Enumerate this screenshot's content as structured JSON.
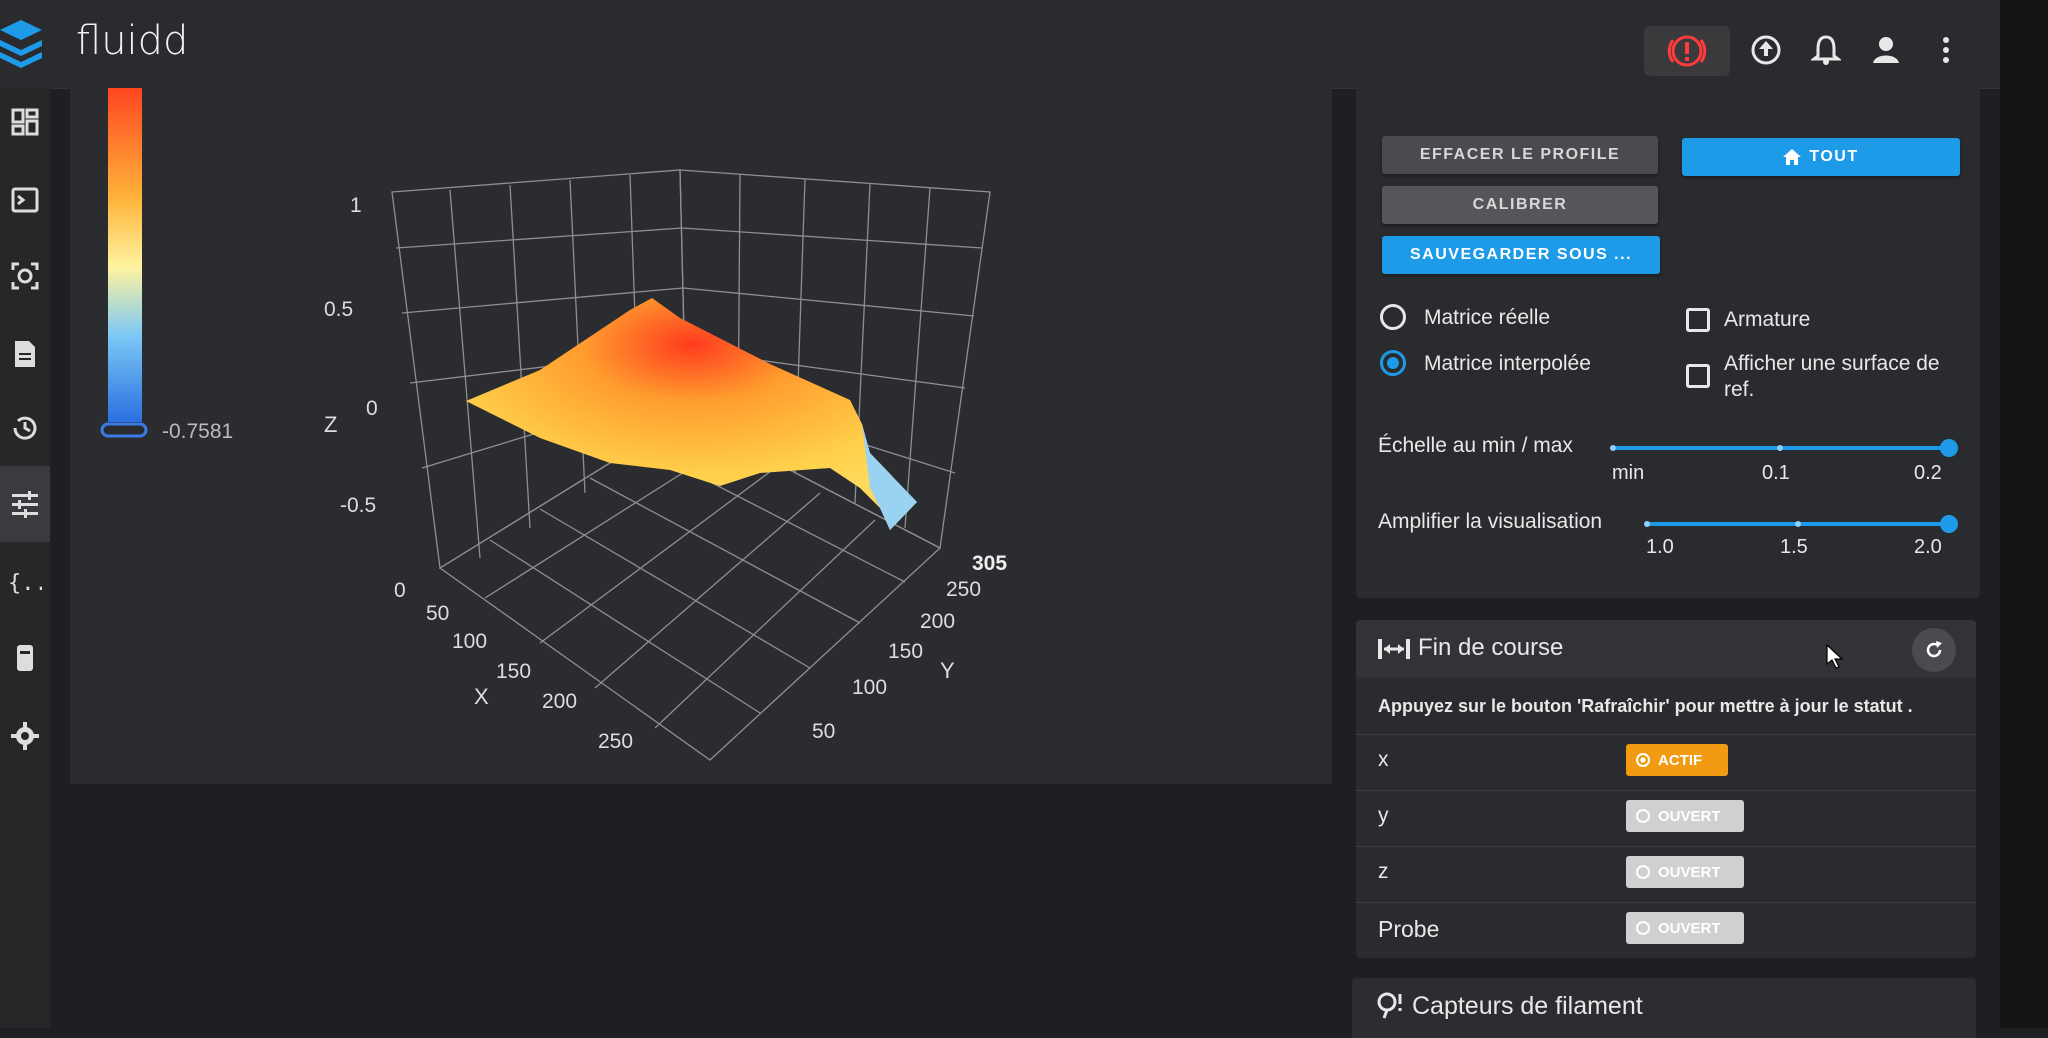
{
  "app": {
    "title": "fluidd"
  },
  "topbar": {
    "icons": [
      "emergency-stop-icon",
      "upload-icon",
      "bell-icon",
      "account-icon",
      "more-vert-icon"
    ]
  },
  "sidebar": {
    "items": [
      {
        "icon": "dashboard-icon"
      },
      {
        "icon": "console-icon"
      },
      {
        "icon": "camera-icon"
      },
      {
        "icon": "files-icon"
      },
      {
        "icon": "history-icon"
      },
      {
        "icon": "tune-icon",
        "active": true
      },
      {
        "icon": "macros-icon"
      },
      {
        "icon": "device-icon"
      },
      {
        "icon": "settings-icon"
      }
    ]
  },
  "mesh_plot": {
    "colorbar_min_label": "-0.7581",
    "axes": {
      "z_label": "Z",
      "x_label": "X",
      "y_label": "Y",
      "z_ticks": [
        "1",
        "0.5",
        "0",
        "-0.5"
      ],
      "x_ticks": [
        "50",
        "100",
        "150",
        "200",
        "250"
      ],
      "y_ticks": [
        "50",
        "100",
        "150",
        "200",
        "250",
        "305"
      ],
      "origin_tick": "0"
    }
  },
  "bed_mesh_card": {
    "clear_profile_label": "EFFACER LE PROFILE",
    "home_all_label": "TOUT",
    "calibrate_label": "CALIBRER",
    "save_as_label": "SAUVEGARDER SOUS ...",
    "radio_real_label": "Matrice réelle",
    "radio_interp_label": "Matrice interpolée",
    "radio_selected": "interpolated",
    "wireframe_label": "Armature",
    "flat_surface_label_1": "Afficher une surface de",
    "flat_surface_label_2": "ref.",
    "scale_label": "Échelle au min / max",
    "scale_ticks": [
      "min",
      "0.1",
      "0.2"
    ],
    "scale_value": 0.2,
    "amplify_label": "Amplifier la visualisation",
    "amplify_ticks": [
      "1.0",
      "1.5",
      "2.0"
    ],
    "amplify_value": 2.0
  },
  "endstops_card": {
    "title": "Fin de course",
    "hint": "Appuyez sur le bouton 'Rafraîchir' pour mettre à jour le statut .",
    "rows": [
      {
        "name": "x",
        "state": "ACTIF",
        "active": true
      },
      {
        "name": "y",
        "state": "OUVERT",
        "active": false
      },
      {
        "name": "z",
        "state": "OUVERT",
        "active": false
      },
      {
        "name": "Probe",
        "state": "OUVERT",
        "active": false
      }
    ]
  },
  "filament_card": {
    "title": "Capteurs de filament"
  },
  "colors": {
    "accent": "#1e9be8",
    "active_chip": "#f29b12",
    "background": "#1e1f22"
  }
}
